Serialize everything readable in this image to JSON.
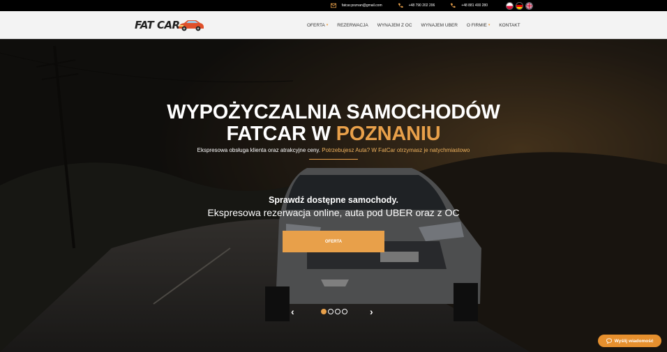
{
  "topbar": {
    "email": "fatcar.poznan@gmail.com",
    "phone1": "+48 790 202 206",
    "phone2": "+48 881 400 280",
    "languages": [
      "Polski",
      "Deutsch",
      "English"
    ]
  },
  "brand": {
    "logo_text": "FAT CAR"
  },
  "menu": {
    "items": [
      {
        "label": "Oferta",
        "has_dropdown": true
      },
      {
        "label": "Rezerwacja",
        "has_dropdown": false
      },
      {
        "label": "Wynajem z OC",
        "has_dropdown": false
      },
      {
        "label": "Wynajem UBER",
        "has_dropdown": false
      },
      {
        "label": "O firmie",
        "has_dropdown": true
      },
      {
        "label": "Kontakt",
        "has_dropdown": false
      }
    ]
  },
  "hero": {
    "title_line1": "WYPOŻYCZALNIA SAMOCHODÓW",
    "title_line2_prefix": "FATCAR W ",
    "title_line2_accent": "POZNANIU",
    "subtitle_prefix": "Ekspresowa obsługa klienta oraz atrakcyjne ceny. ",
    "subtitle_accent": "Potrzebujesz Auta? W FatCar otrzymasz je natychmiastowo",
    "slide_heading": "Sprawdź dostępne samochody.",
    "slide_text": "Ekspresowa rezerwacja online, auta pod UBER oraz z OC",
    "cta_label": "OFERTA",
    "slides_count": 4,
    "active_slide": 1
  },
  "chat": {
    "label": "Wyślij wiadomość"
  },
  "colors": {
    "accent": "#e8a04a",
    "topbar": "#000000",
    "nav": "#f3f3f3"
  }
}
